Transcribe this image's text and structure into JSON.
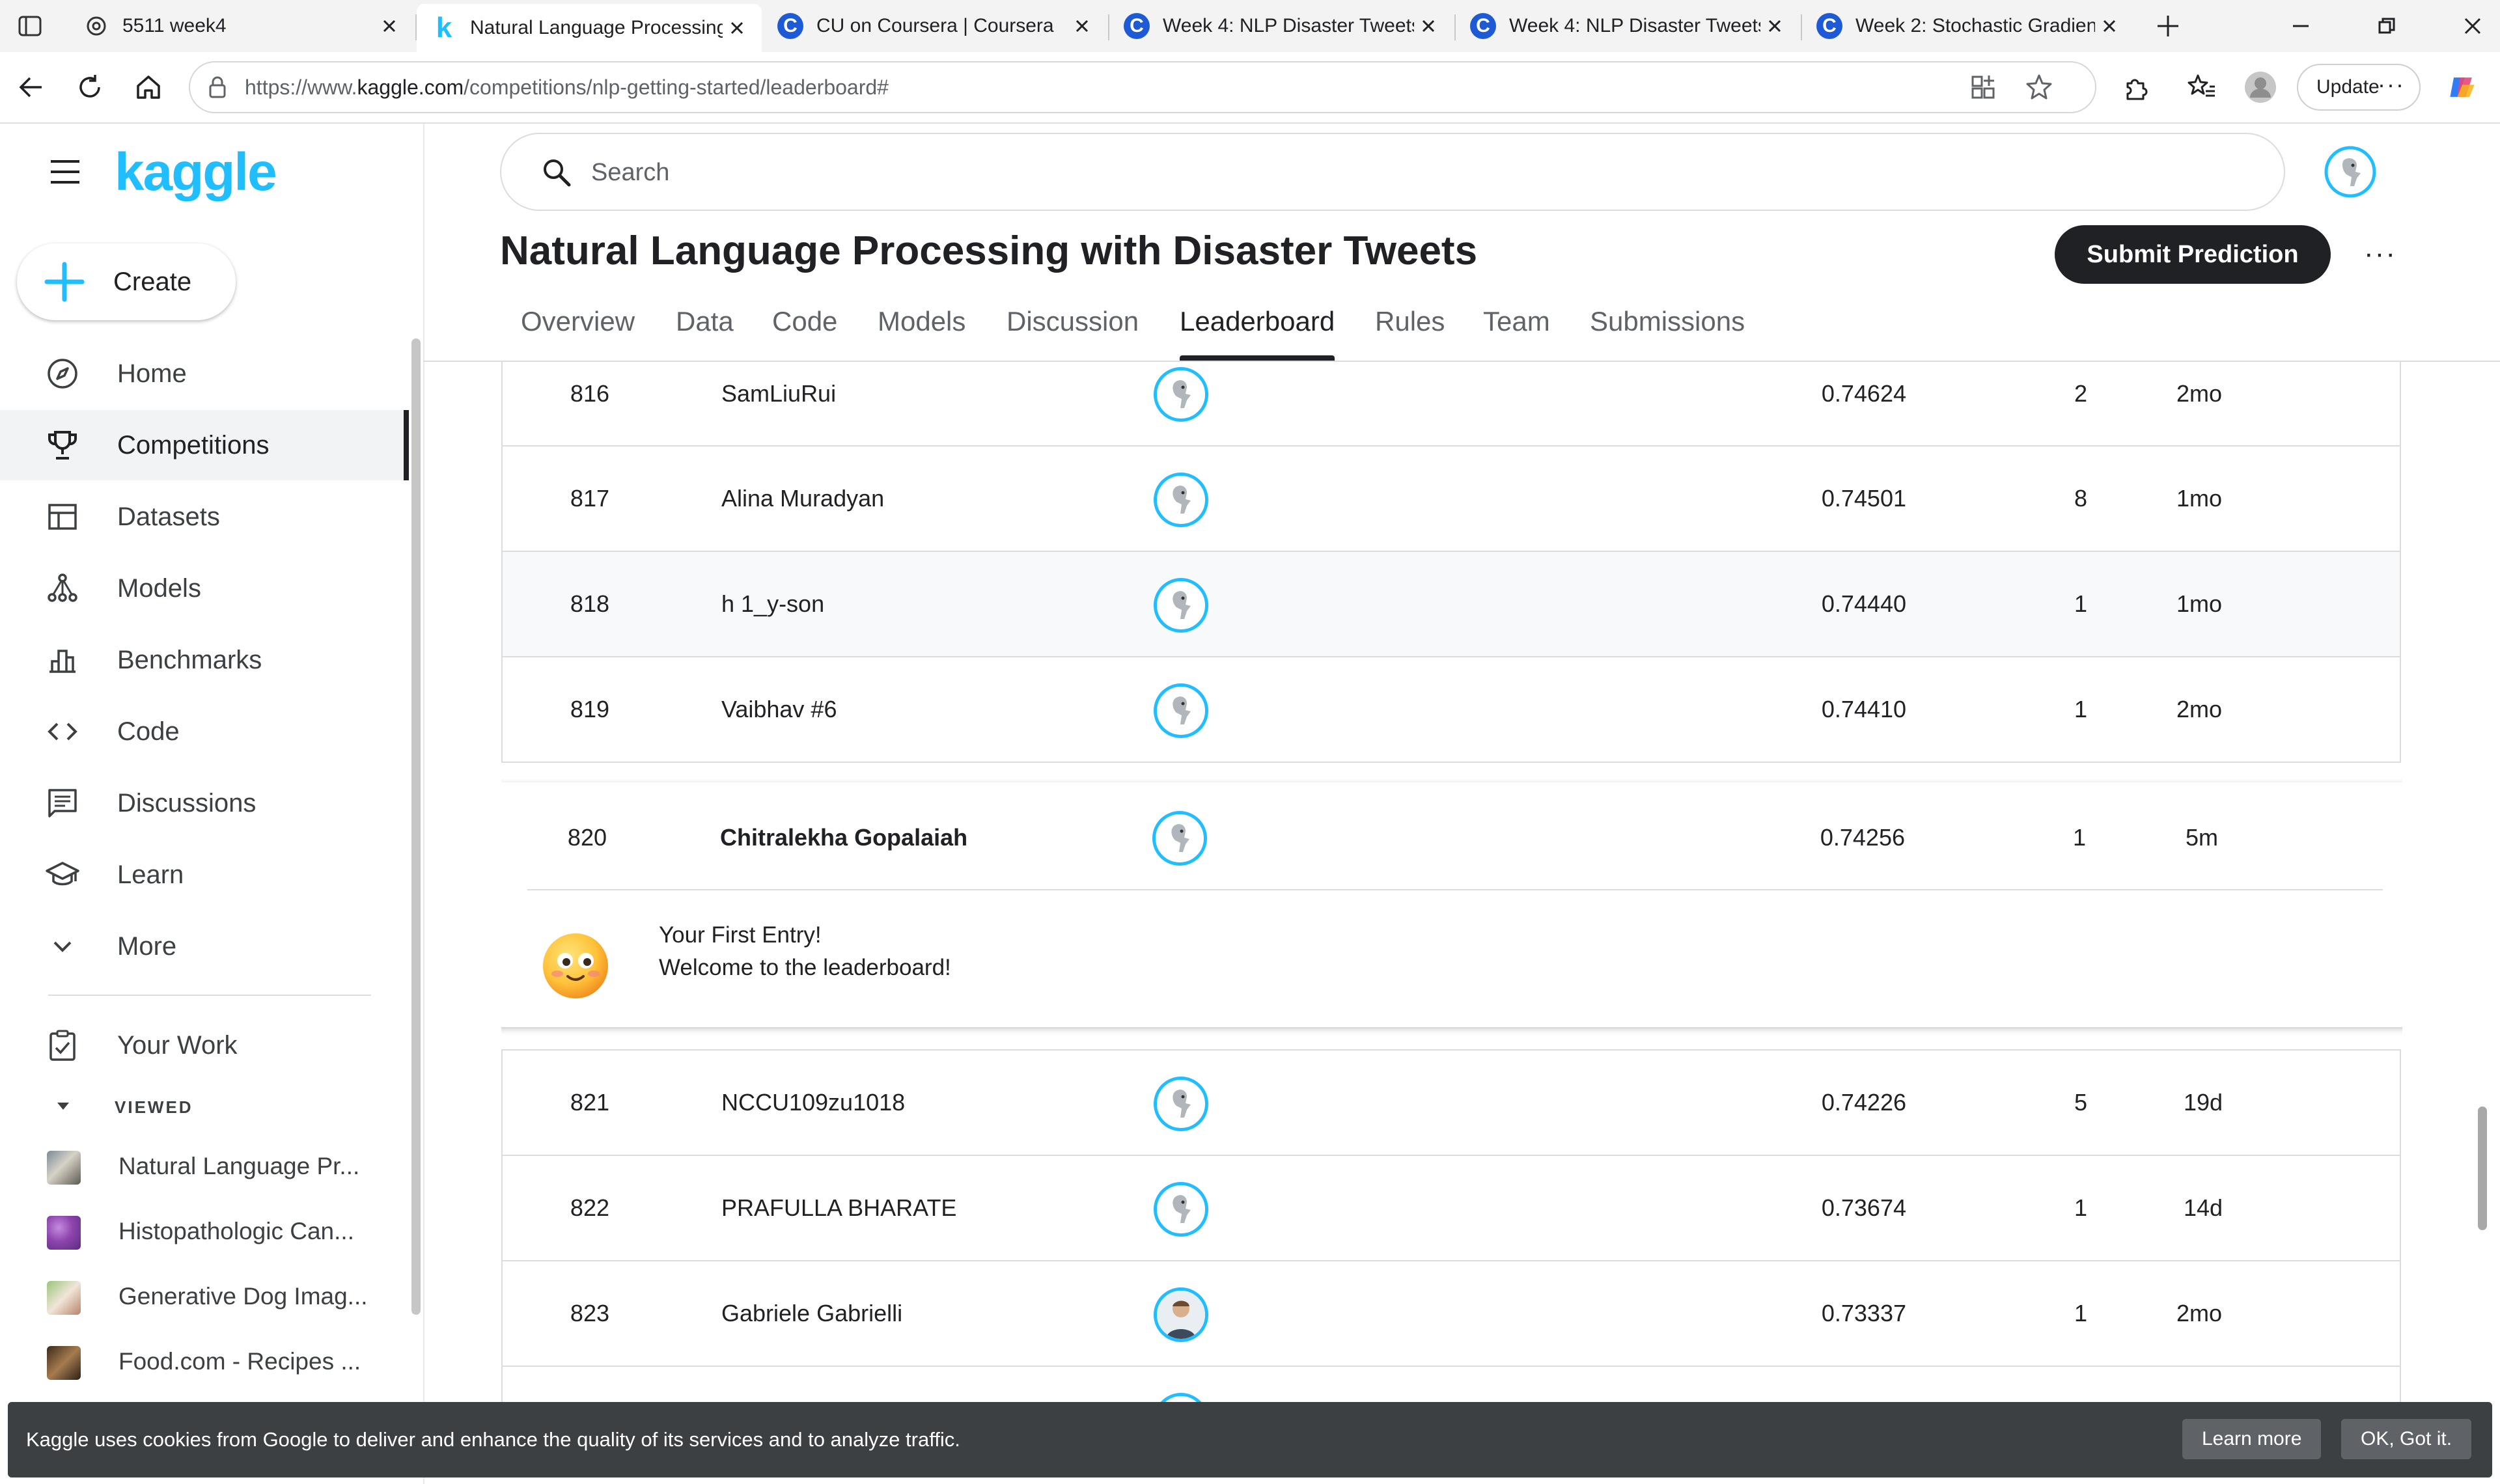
{
  "browser": {
    "tabs": [
      {
        "title": "5511 week4",
        "favicon": "chatgpt-icon"
      },
      {
        "title": "Natural Language Processing",
        "favicon": "kaggle-icon",
        "active": true
      },
      {
        "title": "CU on Coursera | Coursera",
        "favicon": "coursera-icon"
      },
      {
        "title": "Week 4: NLP Disaster Tweets",
        "favicon": "coursera-icon"
      },
      {
        "title": "Week 4: NLP Disaster Tweets",
        "favicon": "coursera-icon"
      },
      {
        "title": "Week 2: Stochastic Gradient",
        "favicon": "coursera-icon"
      }
    ],
    "url_prefix": "https://www.",
    "url_host": "kaggle.com",
    "url_path": "/competitions/nlp-getting-started/leaderboard#",
    "update_label": "Update"
  },
  "sidebar": {
    "logo": "kaggle",
    "create_label": "Create",
    "nav": [
      {
        "label": "Home",
        "icon": "compass-icon"
      },
      {
        "label": "Competitions",
        "icon": "trophy-icon",
        "active": true
      },
      {
        "label": "Datasets",
        "icon": "table-icon"
      },
      {
        "label": "Models",
        "icon": "models-icon"
      },
      {
        "label": "Benchmarks",
        "icon": "bar-chart-icon"
      },
      {
        "label": "Code",
        "icon": "code-icon"
      },
      {
        "label": "Discussions",
        "icon": "comment-icon"
      },
      {
        "label": "Learn",
        "icon": "school-icon"
      },
      {
        "label": "More",
        "icon": "chevron-down-icon"
      }
    ],
    "your_work": "Your Work",
    "viewed_header": "VIEWED",
    "viewed": [
      {
        "label": "Natural Language Pr..."
      },
      {
        "label": "Histopathologic Can..."
      },
      {
        "label": "Generative Dog Imag..."
      },
      {
        "label": "Food.com - Recipes ..."
      }
    ]
  },
  "header": {
    "search_placeholder": "Search",
    "title": "Natural Language Processing with Disaster Tweets",
    "submit_label": "Submit Prediction",
    "tabs": [
      "Overview",
      "Data",
      "Code",
      "Models",
      "Discussion",
      "Leaderboard",
      "Rules",
      "Team",
      "Submissions"
    ],
    "active_tab": "Leaderboard"
  },
  "leaderboard": {
    "rows_before": [
      {
        "rank": "816",
        "team": "SamLiuRui",
        "score": "0.74624",
        "entries": "2",
        "last": "2mo"
      },
      {
        "rank": "817",
        "team": "Alina Muradyan",
        "score": "0.74501",
        "entries": "8",
        "last": "1mo"
      },
      {
        "rank": "818",
        "team": "h 1_y-son",
        "score": "0.74440",
        "entries": "1",
        "last": "1mo"
      },
      {
        "rank": "819",
        "team": "Vaibhav #6",
        "score": "0.74410",
        "entries": "1",
        "last": "2mo"
      }
    ],
    "my_entry": {
      "rank": "820",
      "team": "Chitralekha Gopalaiah",
      "score": "0.74256",
      "entries": "1",
      "last": "5m"
    },
    "welcome_line1": "Your First Entry!",
    "welcome_line2": "Welcome to the leaderboard!",
    "rows_after": [
      {
        "rank": "821",
        "team": "NCCU109zu1018",
        "score": "0.74226",
        "entries": "5",
        "last": "19d"
      },
      {
        "rank": "822",
        "team": "PRAFULLA BHARATE",
        "score": "0.73674",
        "entries": "1",
        "last": "14d"
      },
      {
        "rank": "823",
        "team": "Gabriele Gabrielli",
        "score": "0.73337",
        "entries": "1",
        "last": "2mo"
      }
    ]
  },
  "cookie": {
    "text": "Kaggle uses cookies from Google to deliver and enhance the quality of its services and to analyze traffic.",
    "learn_more": "Learn more",
    "ok": "OK, Got it."
  },
  "colors": {
    "kaggle_blue": "#20beff",
    "dark": "#202124",
    "banner": "#3c4043"
  }
}
